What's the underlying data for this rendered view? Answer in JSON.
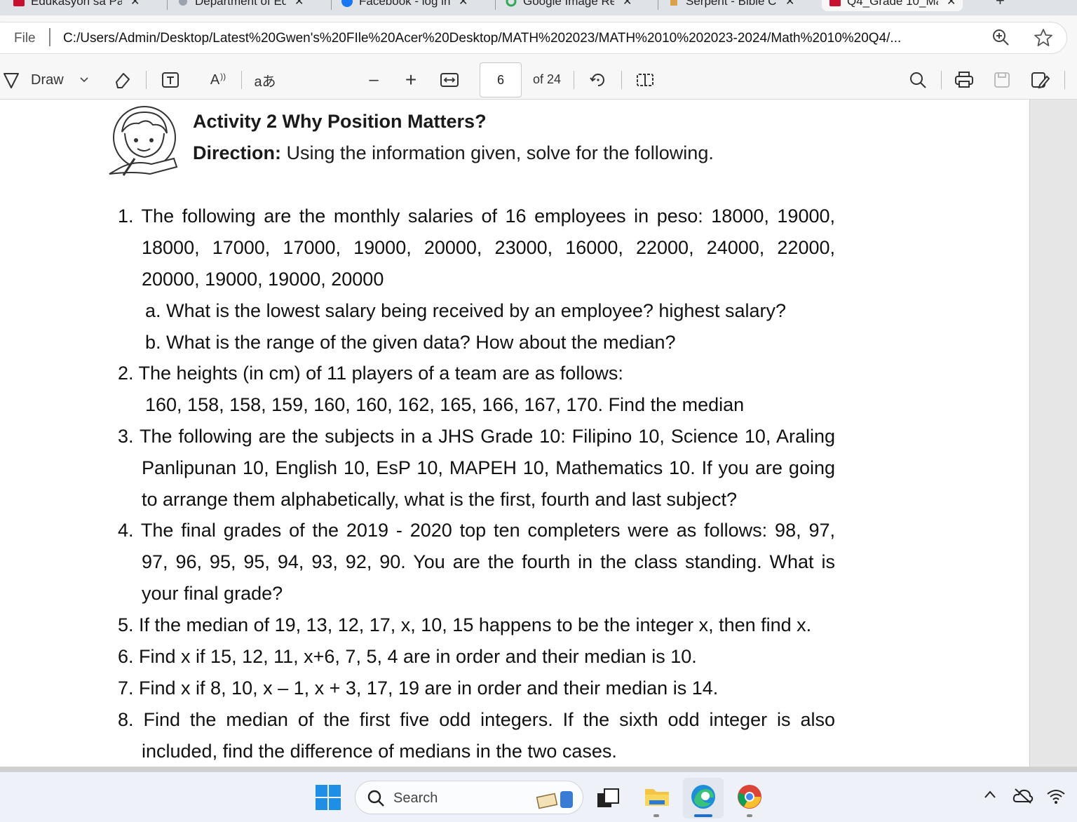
{
  "browser": {
    "tabs": [
      {
        "title": "Edukasyon sa Pag",
        "close": "✕"
      },
      {
        "title": "Department of Ed",
        "close": "✕"
      },
      {
        "title": "Facebook - log in",
        "close": "✕"
      },
      {
        "title": "Google Image Re",
        "close": "✕"
      },
      {
        "title": "Serpent - Bible Co",
        "close": "✕"
      },
      {
        "title": "Q4_Grade 10_Ma",
        "close": "✕"
      }
    ],
    "new_tab": "+",
    "site_label": "File",
    "url": "C:/Users/Admin/Desktop/Latest%20Gwen's%20FIle%20Acer%20Desktop/MATH%202023/MATH%2010%202023-2024/Math%2010%20Q4/..."
  },
  "pdf_toolbar": {
    "draw_label": "Draw",
    "page_current": "6",
    "page_total": "of 24",
    "text_size_glyph": "A",
    "read_aloud_glyph": "aあ",
    "minus": "–",
    "plus": "+"
  },
  "document": {
    "activity_title": "Activity 2  Why Position Matters?",
    "direction_label": "Direction:",
    "direction_text": " Using the information given, solve for the following.",
    "lines": {
      "l1": "1. The following are the monthly salaries of 16 employees in peso: 18000, 19000,",
      "l2": "18000,  17000,  17000,  19000,  20000,  23000,  16000,  22000,  24000,  22000,",
      "l3": "20000, 19000, 19000, 20000",
      "l4": "a.  What is the lowest salary being received by an employee? highest salary?",
      "l5": "b.  What is the range of the given data? How about the median?",
      "l6": "2. The heights (in cm) of 11 players of a team are as follows:",
      "l7": "160,  158,  158,  159,  160,  160,  162,  165,  166,  167,  170. Find the median",
      "l8": "3. The following are the subjects in a JHS Grade 10: Filipino 10, Science 10, Araling",
      "l9": "Panlipunan 10, English 10, EsP 10, MAPEH 10, Mathematics 10. If you are going",
      "l10": "to arrange them alphabetically, what is the first, fourth and last subject?",
      "l11": "4. The final grades of the 2019 - 2020 top ten completers were as follows: 98, 97,",
      "l12": "97, 96, 95, 95, 94, 93, 92, 90. You are the fourth in the class standing. What is",
      "l13": "your final grade?",
      "l14": "5. If the median of 19, 13, 12, 17, x, 10, 15 happens to be the integer x, then find x.",
      "l15": "6. Find x if 15, 12, 11, x+6, 7, 5, 4 are in order and their median is 10.",
      "l16": "7. Find x if 8, 10, x – 1, x + 3, 17, 19 are in order and their median is 14.",
      "l17": "8.  Find  the  median  of  the  first  five  odd  integers.  If  the  sixth  odd  integer  is  also",
      "l18": "included, find the difference of medians in the two cases."
    }
  },
  "taskbar": {
    "search_placeholder": "Search",
    "tray_chevron": "^"
  }
}
